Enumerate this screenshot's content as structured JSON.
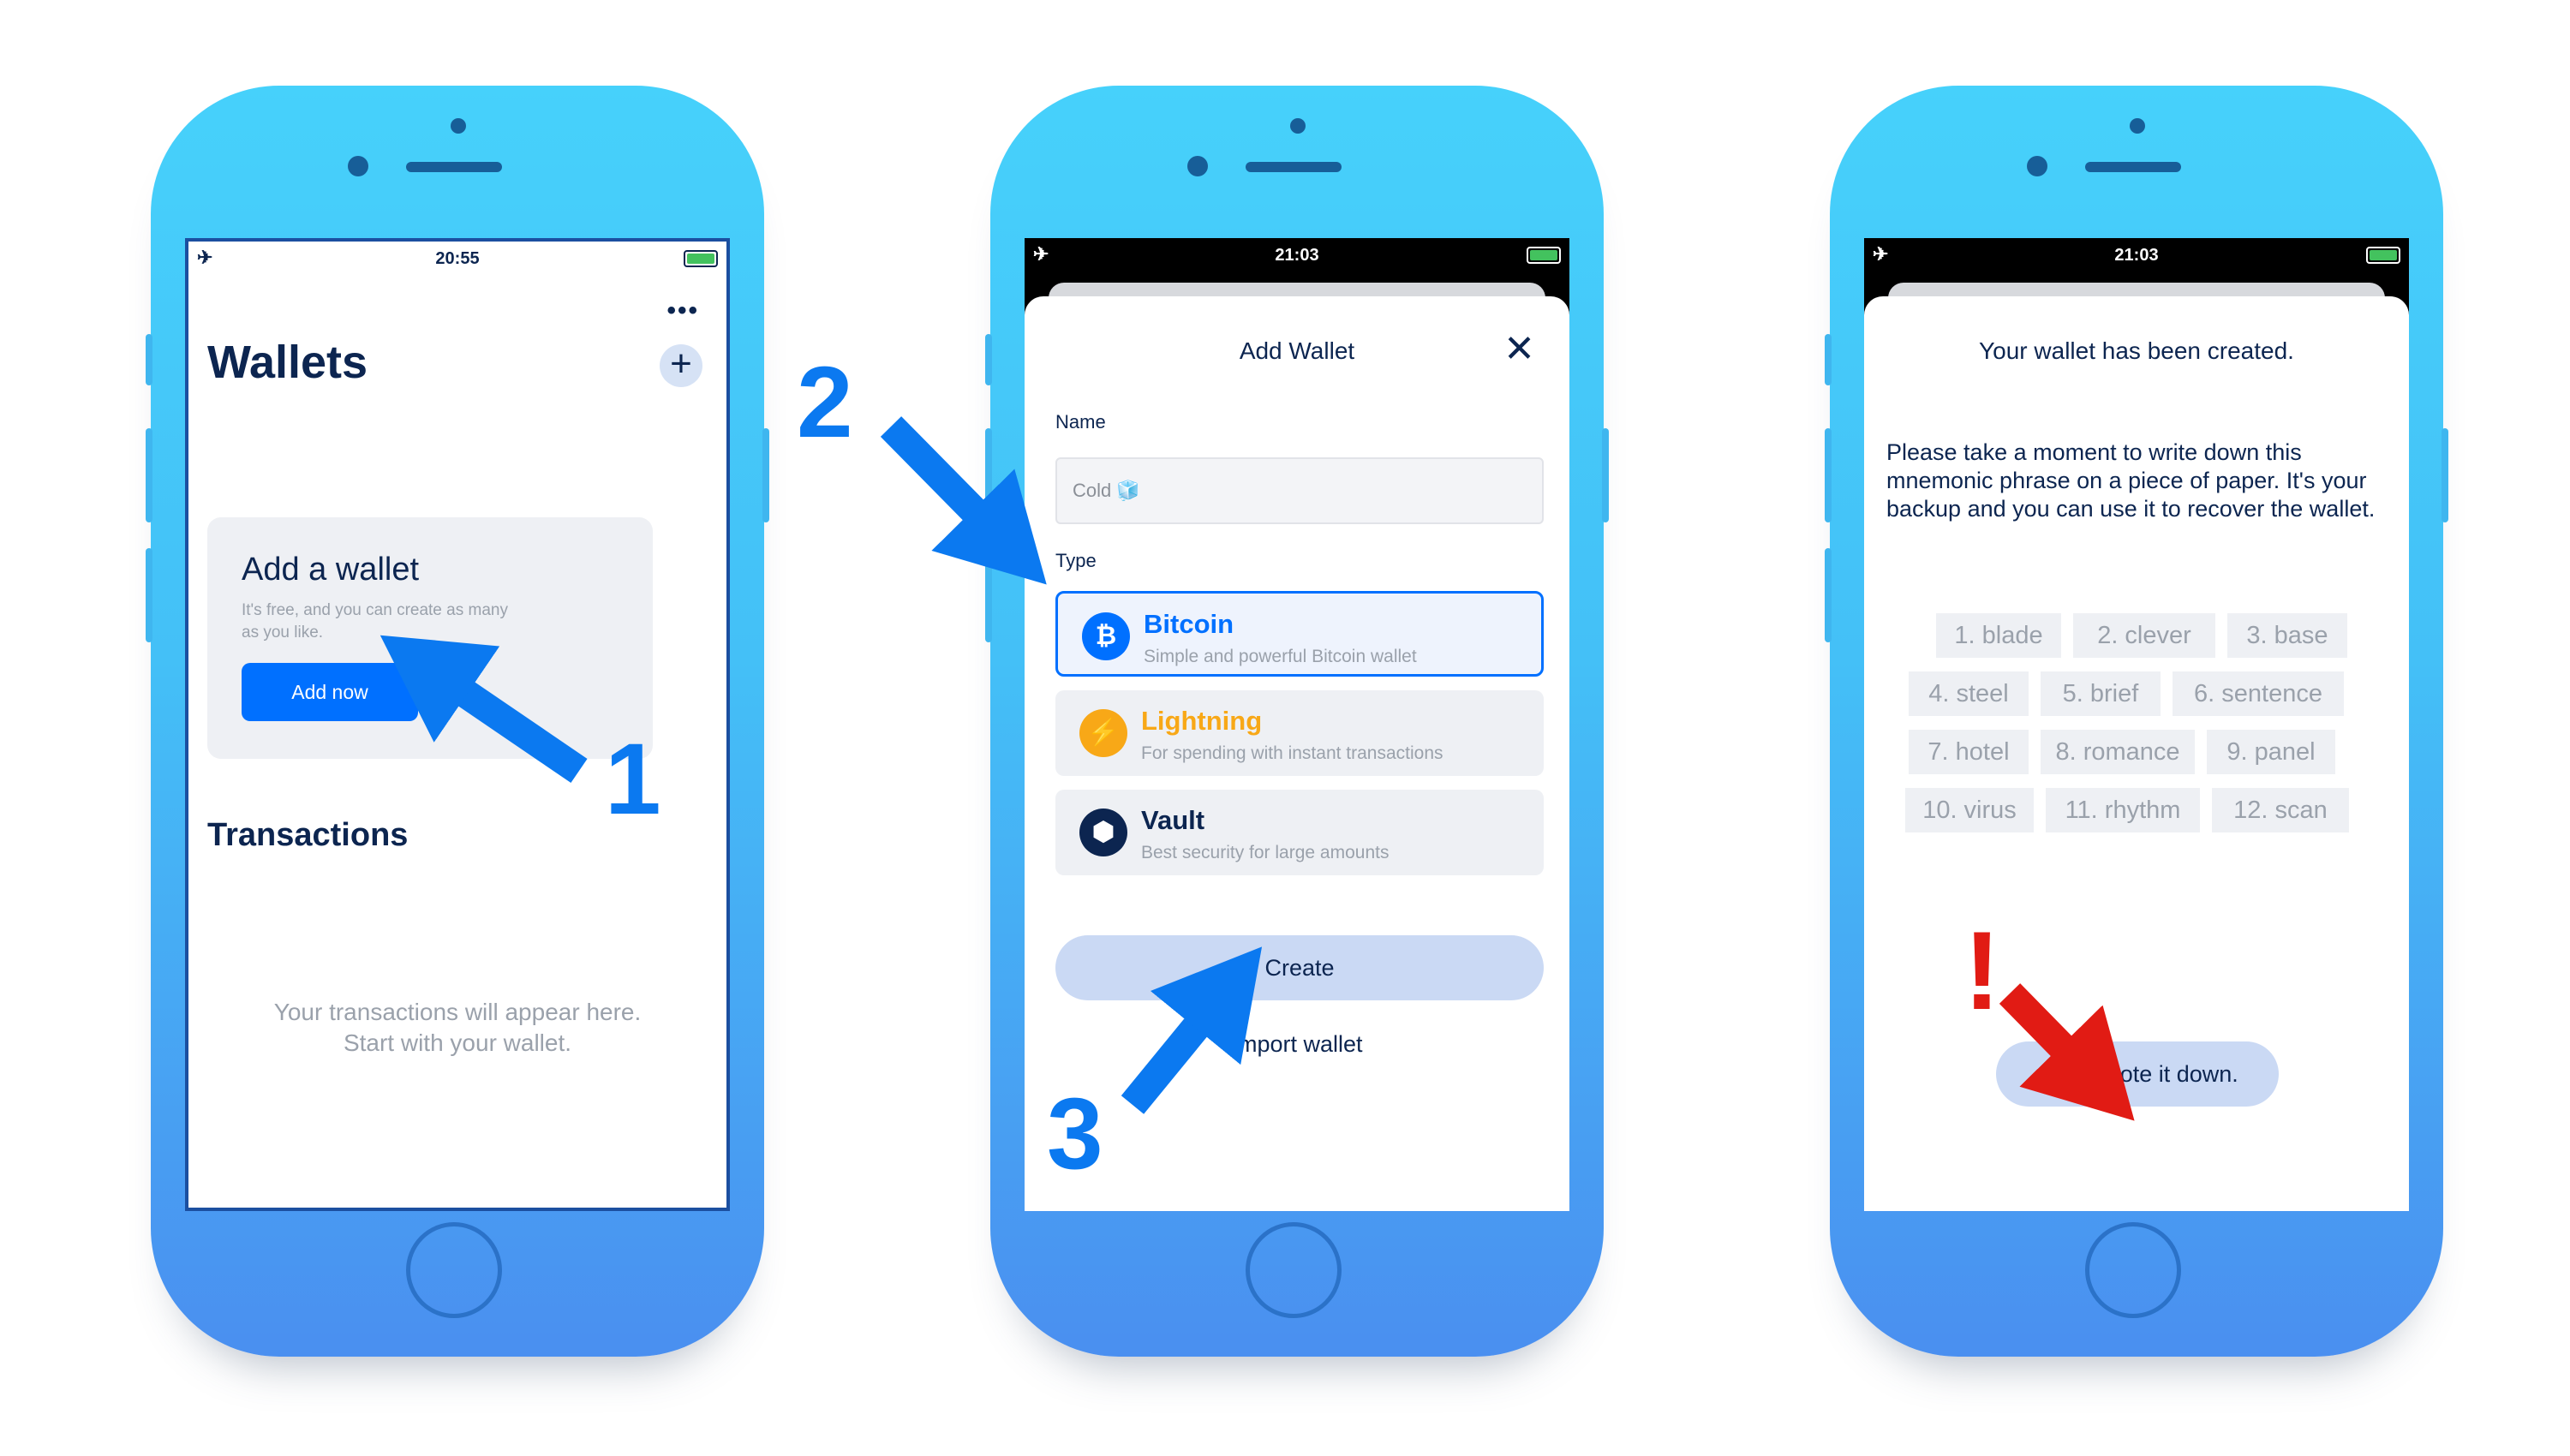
{
  "status_times": {
    "phone1": "20:55",
    "phone2": "21:03",
    "phone3": "21:03"
  },
  "step_numbers": [
    "1",
    "2",
    "3"
  ],
  "wallets_screen": {
    "title": "Wallets",
    "add_card": {
      "title": "Add a wallet",
      "subtitle": "It's free, and you can create as many as you like.",
      "button": "Add now"
    },
    "transactions_title": "Transactions",
    "empty_line1": "Your transactions will appear here.",
    "empty_line2": "Start with your wallet."
  },
  "add_wallet_screen": {
    "title": "Add Wallet",
    "name_label": "Name",
    "name_value": "Cold 🧊",
    "type_label": "Type",
    "types": [
      {
        "title": "Bitcoin",
        "desc": "Simple and powerful Bitcoin wallet",
        "color": "#0070ff",
        "icon": "bitcoin-icon",
        "selected": true
      },
      {
        "title": "Lightning",
        "desc": "For spending with instant transactions",
        "color": "#f8a817",
        "icon": "lightning-icon",
        "selected": false
      },
      {
        "title": "Vault",
        "desc": "Best security for large amounts",
        "color": "#0c2550",
        "icon": "vault-icon",
        "selected": false
      }
    ],
    "create_button": "Create",
    "import_link": "Import wallet"
  },
  "created_screen": {
    "title": "Your wallet has been created.",
    "instructions": "Please take a moment to write down this mnemonic phrase on a piece of paper. It's your backup and you can use it to recover the wallet.",
    "words": [
      "1. blade",
      "2. clever",
      "3. base",
      "4. steel",
      "5. brief",
      "6. sentence",
      "7. hotel",
      "8. romance",
      "9. panel",
      "10. virus",
      "11. rhythm",
      "12. scan"
    ],
    "ok_button": "OK, I wrote it down."
  },
  "annotations": {
    "warning_mark": "!",
    "arrow_color": "#0b79f0",
    "warning_color": "#e11b14"
  }
}
